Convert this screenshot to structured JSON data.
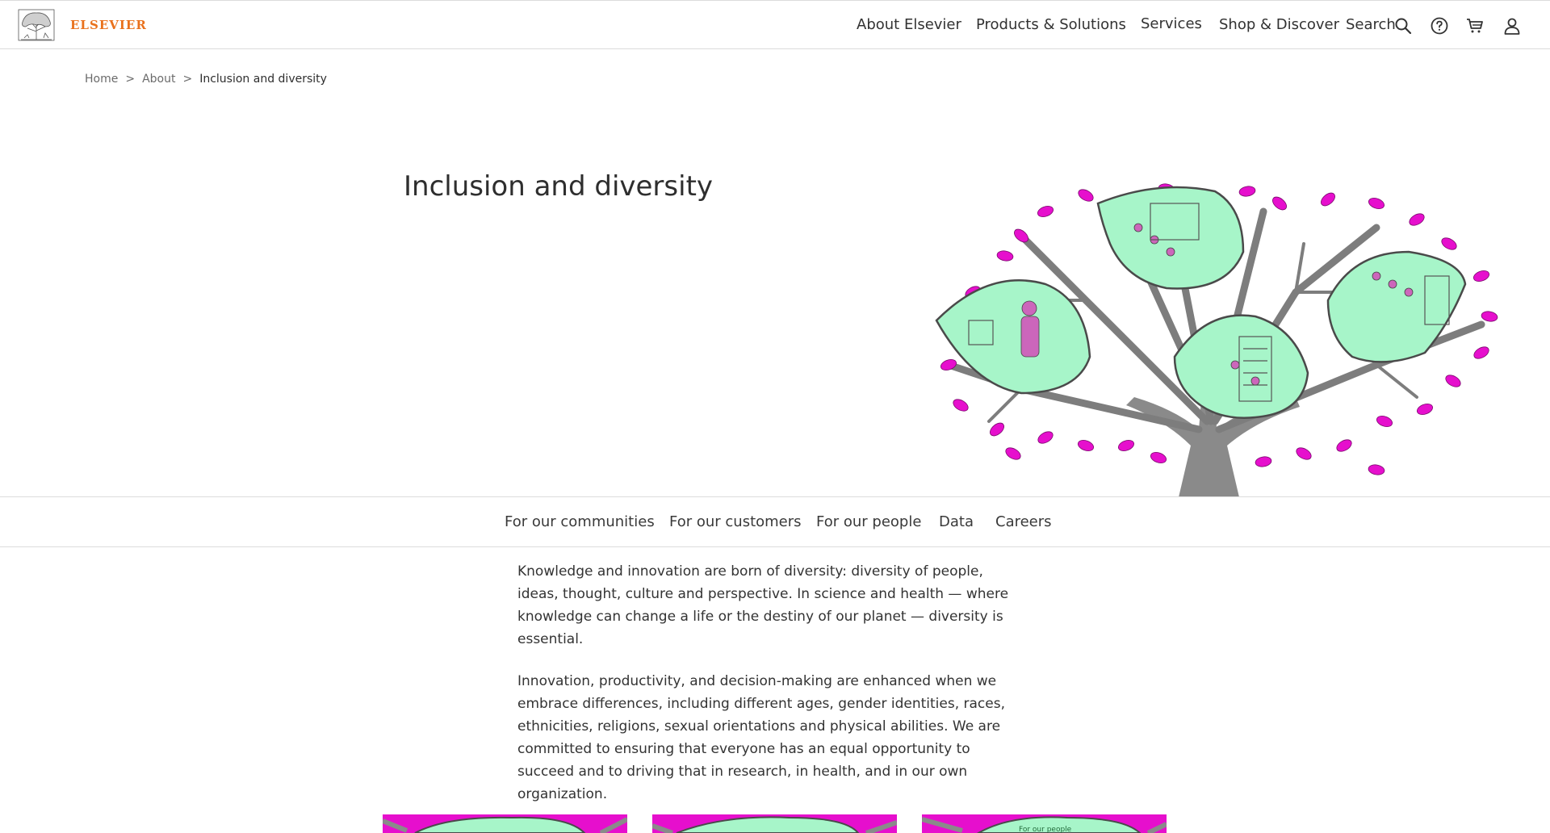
{
  "header": {
    "logo_text": "ELSEVIER",
    "nav": [
      "About Elsevier",
      "Products & Solutions",
      "Services",
      "Shop & Discover"
    ],
    "search_label": "Search",
    "icons": [
      "search-icon",
      "help-icon",
      "cart-icon",
      "user-icon"
    ]
  },
  "breadcrumb": {
    "items": [
      "Home",
      "About",
      "Inclusion and diversity"
    ],
    "separator": ">"
  },
  "hero": {
    "title": "Inclusion and diversity"
  },
  "subnav": {
    "items": [
      "For our communities",
      "For our customers",
      "For our people",
      "Data",
      "Careers"
    ]
  },
  "body": {
    "paragraphs": [
      "Knowledge and innovation are born of diversity: diversity of people, ideas, thought, culture and perspective. In science and health — where knowledge can change a life or the destiny of our planet — diversity is essential.",
      "Innovation, productivity, and decision-making are enhanced when we embrace differences, including different ages, gender identities, races, ethnicities, religions, sexual orientations and physical abilities. We are committed to ensuring that everyone has an equal opportunity to succeed and to driving that in research, in health, and in our own organization."
    ]
  },
  "cards": {
    "third_label": "For our people"
  },
  "colors": {
    "brand_orange": "#e9711c",
    "leaf_magenta": "#e60fcd",
    "mint": "#a7f5c9",
    "trunk_grey": "#8a8a8a"
  }
}
